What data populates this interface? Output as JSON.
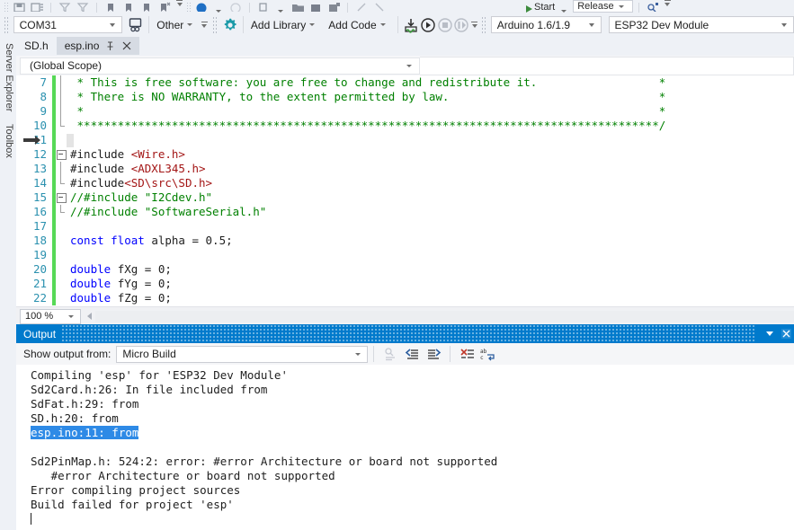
{
  "toolbar_top": {
    "start_label": "Start",
    "config_label": "Release",
    "icons": [
      "save-icon",
      "save-all-icon",
      "filter-icon",
      "filter-clear-icon",
      "bookmark-icon",
      "bookmark-prev-icon",
      "bookmark-next-icon",
      "bookmark-clear-icon",
      "undo-icon",
      "redo-icon",
      "navigate-back-icon",
      "navigate-forward-icon",
      "find-icon"
    ]
  },
  "toolbar": {
    "port": "COM31",
    "device_icon": "device-icon",
    "programmer": "Other",
    "settings_icon": "gear-icon",
    "add_library": "Add Library",
    "add_code": "Add Code",
    "upload_icon": "upload-icon",
    "run_icon": "run-icon",
    "stop_icon": "stop-icon",
    "pause_icon": "pause-icon",
    "arduino_version": "Arduino 1.6/1.9",
    "board": "ESP32 Dev Module"
  },
  "vdock": {
    "items": [
      {
        "label": "Server Explorer"
      },
      {
        "label": "Toolbox"
      }
    ]
  },
  "tabs": [
    {
      "label": "SD.h",
      "active": false
    },
    {
      "label": "esp.ino",
      "active": true,
      "pin_icon": "pin-icon",
      "close_icon": "close-icon"
    }
  ],
  "scope": {
    "value": "(Global Scope)"
  },
  "editor": {
    "zoom": "100 %",
    "lines": [
      {
        "num": "7",
        "fold": "line",
        "segments": [
          {
            "t": " * This is free software: you are free to change and redistribute it.                  *",
            "c": "c-cmt"
          }
        ]
      },
      {
        "num": "8",
        "fold": "line",
        "segments": [
          {
            "t": " * There is NO WARRANTY, to the extent permitted by law.                               *",
            "c": "c-cmt"
          }
        ]
      },
      {
        "num": "9",
        "fold": "line",
        "segments": [
          {
            "t": " *                                                                                     *",
            "c": "c-cmt"
          }
        ]
      },
      {
        "num": "10",
        "fold": "end",
        "segments": [
          {
            "t": " **************************************************************************************/",
            "c": "c-cmt"
          }
        ]
      },
      {
        "num": "11",
        "fold": "none",
        "marker": true,
        "segments": [
          {
            "t": "",
            "c": "c-pp"
          }
        ]
      },
      {
        "num": "12",
        "fold": "box",
        "segments": [
          {
            "t": "#include ",
            "c": "c-pp"
          },
          {
            "t": "<Wire.h>",
            "c": "c-inc"
          }
        ]
      },
      {
        "num": "13",
        "fold": "line",
        "segments": [
          {
            "t": "#include ",
            "c": "c-pp"
          },
          {
            "t": "<ADXL345.h>",
            "c": "c-inc"
          }
        ]
      },
      {
        "num": "14",
        "fold": "end",
        "segments": [
          {
            "t": "#include",
            "c": "c-pp"
          },
          {
            "t": "<SD\\src\\SD.h>",
            "c": "c-inc"
          }
        ]
      },
      {
        "num": "15",
        "fold": "box",
        "segments": [
          {
            "t": "//#include \"I2Cdev.h\"",
            "c": "c-cmt"
          }
        ]
      },
      {
        "num": "16",
        "fold": "end",
        "segments": [
          {
            "t": "//#include \"SoftwareSerial.h\"",
            "c": "c-cmt"
          }
        ]
      },
      {
        "num": "17",
        "fold": "none",
        "segments": [
          {
            "t": "",
            "c": "c-pp"
          }
        ]
      },
      {
        "num": "18",
        "fold": "none",
        "segments": [
          {
            "t": "const ",
            "c": "c-kw"
          },
          {
            "t": "float ",
            "c": "c-kw"
          },
          {
            "t": "alpha = 0.5;",
            "c": "c-num"
          }
        ]
      },
      {
        "num": "19",
        "fold": "none",
        "segments": [
          {
            "t": "",
            "c": "c-pp"
          }
        ]
      },
      {
        "num": "20",
        "fold": "none",
        "segments": [
          {
            "t": "double ",
            "c": "c-kw"
          },
          {
            "t": "fXg = 0;",
            "c": "c-num"
          }
        ]
      },
      {
        "num": "21",
        "fold": "none",
        "segments": [
          {
            "t": "double ",
            "c": "c-kw"
          },
          {
            "t": "fYg = 0;",
            "c": "c-num"
          }
        ]
      },
      {
        "num": "22",
        "fold": "none",
        "segments": [
          {
            "t": "double ",
            "c": "c-kw"
          },
          {
            "t": "fZg = 0;",
            "c": "c-num"
          }
        ]
      }
    ]
  },
  "output": {
    "title": "Output",
    "title_dropdown_icon": "chevron-down-icon",
    "title_close_icon": "close-icon",
    "show_from_label": "Show output from:",
    "source": "Micro Build",
    "toolbar_icons": [
      "find-message-icon",
      "go-to-previous-message-icon",
      "go-to-next-message-icon",
      "clear-all-icon",
      "toggle-word-wrap-icon"
    ],
    "lines": [
      {
        "text": "Compiling 'esp' for 'ESP32 Dev Module'",
        "selected": false
      },
      {
        "text": "Sd2Card.h:26: In file included from",
        "selected": false
      },
      {
        "text": "SdFat.h:29: from",
        "selected": false
      },
      {
        "text": "SD.h:20: from",
        "selected": false
      },
      {
        "text": "esp.ino:11: from",
        "selected": true
      },
      {
        "text": "",
        "selected": false
      },
      {
        "text": "Sd2PinMap.h: 524:2: error: #error Architecture or board not supported",
        "selected": false
      },
      {
        "text": "   #error Architecture or board not supported",
        "selected": false
      },
      {
        "text": "Error compiling project sources",
        "selected": false
      },
      {
        "text": "Build failed for project 'esp'",
        "selected": false
      },
      {
        "text": "",
        "selected": false,
        "cursor": true
      }
    ]
  },
  "colors": {
    "accent": "#007acc",
    "selection": "#2e8ae6",
    "comment": "#008000",
    "include": "#a31515",
    "keyword": "#0000ff",
    "linenumber": "#2b91af",
    "changebar": "#57d957",
    "chrome": "#eef1f6"
  }
}
